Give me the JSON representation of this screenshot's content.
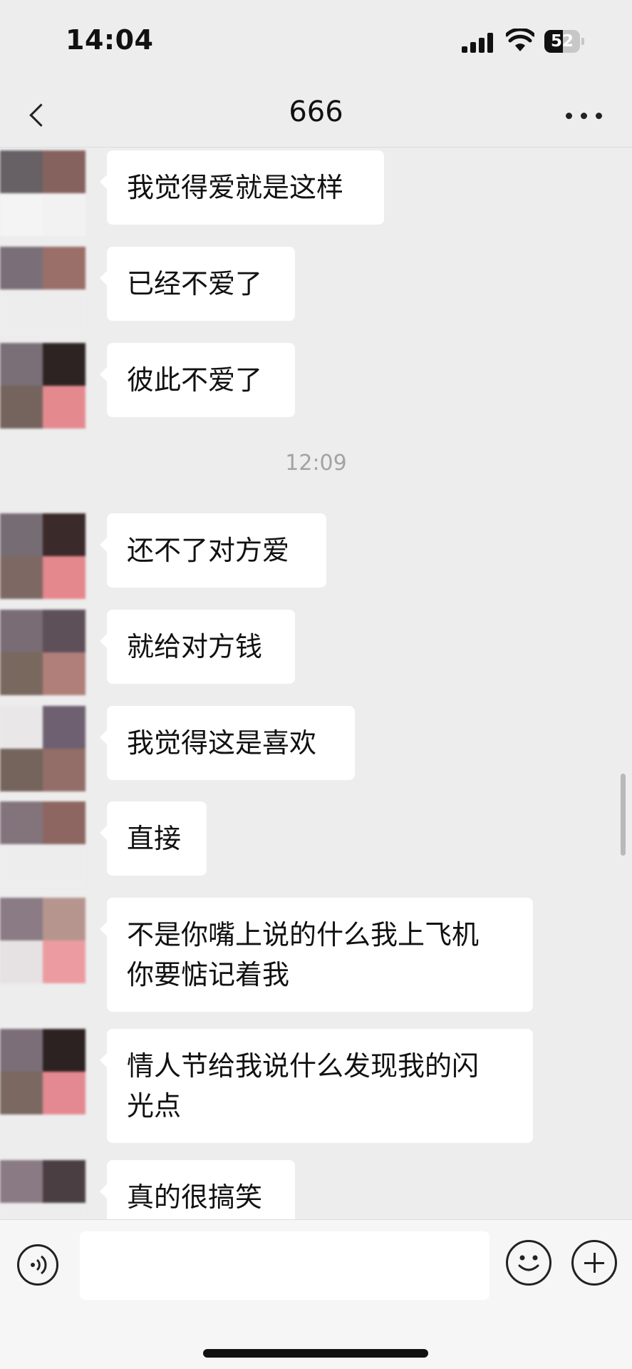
{
  "status_bar": {
    "time": "14:04",
    "battery_level": "52",
    "battery_fraction": 0.52,
    "icons": [
      "signal-icon",
      "wifi-icon",
      "battery-icon"
    ]
  },
  "nav": {
    "title": "666",
    "back_icon": "chevron-left-icon",
    "more_icon": "more-horizontal-icon"
  },
  "messages": [
    {
      "text": "我觉得爱就是这样",
      "avatar_colors": [
        "#676064",
        "#86625f",
        "#f4f4f4",
        "#f2f2f2"
      ]
    },
    {
      "text": "已经不爱了",
      "avatar_colors": [
        "#7a6f78",
        "#9a6f69",
        "#ededed",
        "#ededed"
      ]
    },
    {
      "text": "彼此不爱了",
      "avatar_colors": [
        "#7a6e77",
        "#2e2323",
        "#75645d",
        "#e48a8f"
      ]
    },
    {
      "text": "还不了对方爱",
      "avatar_colors": [
        "#766c74",
        "#3a2a29",
        "#7e6863",
        "#e5888d"
      ]
    },
    {
      "text": "就给对方钱",
      "avatar_colors": [
        "#7a6c74",
        "#5e5059",
        "#79685e",
        "#b07f79"
      ]
    },
    {
      "text": "我觉得这是喜欢",
      "avatar_colors": [
        "#e9e7e8",
        "#6e6070",
        "#75645c",
        "#936e69"
      ]
    },
    {
      "text": "直接",
      "avatar_colors": [
        "#83747c",
        "#8d6661",
        "#ededed",
        "#ededed"
      ]
    },
    {
      "text": "不是你嘴上说的什么我上飞机\n你要惦记着我",
      "avatar_colors": [
        "#8a7b84",
        "#b7958f",
        "#e6e2e3",
        "#ec9ca0"
      ]
    },
    {
      "text": "情人节给我说什么发现我的闪\n光点",
      "avatar_colors": [
        "#7b6e78",
        "#2d2222",
        "#7a6861",
        "#e48991"
      ]
    },
    {
      "text": "真的很搞笑",
      "avatar_colors": [
        "#8a7a84",
        "#4a3e43",
        "#ededed",
        "#ededed"
      ]
    }
  ],
  "timestamp": "12:09",
  "input_bar": {
    "voice_icon": "voice-icon",
    "text_value": "",
    "emoji_icon": "emoji-icon",
    "plus_icon": "plus-icon"
  }
}
